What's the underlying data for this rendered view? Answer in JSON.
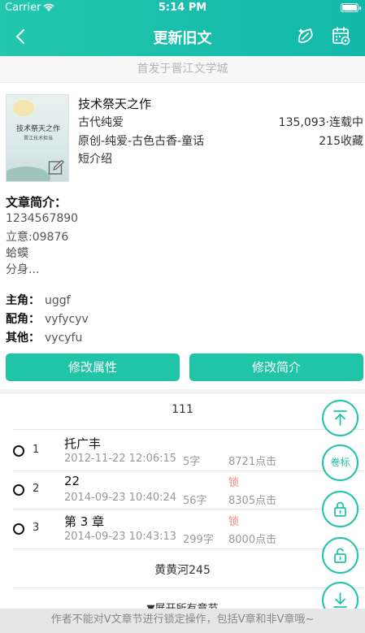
{
  "status_bar": {
    "carrier": "Carrier",
    "time": "5:14 PM"
  },
  "nav": {
    "title": "更新旧文",
    "back_icon": "chevron-left-icon",
    "action_icons": [
      "pencil-sparkle-icon",
      "calendar-settings-icon"
    ]
  },
  "subtitle": "首发于晋江文学城",
  "book": {
    "title": "技术祭天之作",
    "genre": "古代纯爱",
    "tags": "原创-纯爱-古色古香-童话",
    "short_intro": "短介绍",
    "stats": "135,093·连载中",
    "favorites": "215收藏",
    "cover_title": "技术祭天之作",
    "cover_subtitle": "晋江技术担当"
  },
  "intro": {
    "heading": "文章简介：",
    "lines": [
      "1234567890",
      "立意:09876",
      "蛤蟆",
      "分身..."
    ]
  },
  "roles": [
    {
      "label": "主角：",
      "value": "uggf"
    },
    {
      "label": "配角：",
      "value": "vyfycyv"
    },
    {
      "label": "其他：",
      "value": "vycyfu"
    }
  ],
  "buttons": {
    "edit_attributes": "修改属性",
    "edit_intro": "修改简介"
  },
  "volume_1": {
    "title": "111"
  },
  "chapters": [
    {
      "num": "1",
      "title": "托广丰",
      "time": "2012-11-22 12:06:15",
      "words": "5字",
      "lock": "",
      "clicks": "8721点击"
    },
    {
      "num": "2",
      "title": "22",
      "time": "2014-09-23 10:40:24",
      "words": "56字",
      "lock": "锁",
      "clicks": "8305点击"
    },
    {
      "num": "3",
      "title": "第 3 章",
      "time": "2014-09-23 10:43:13",
      "words": "299字",
      "lock": "锁",
      "clicks": "8000点击"
    }
  ],
  "volume_2": {
    "title": "黄黄河245"
  },
  "expand_label": "▼展开所有章节",
  "floating": {
    "volume_label": "卷标"
  },
  "footer": "作者不能对V文章节进行锁定操作，包括V章和非V章哦~",
  "colors": {
    "accent": "#20c4a6",
    "lock": "#f08a80"
  }
}
